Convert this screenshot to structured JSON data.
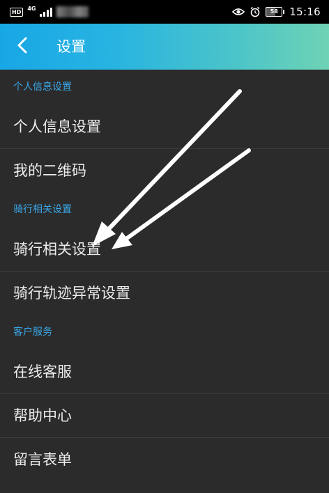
{
  "status_bar": {
    "hd": "HD",
    "network": "4G",
    "battery": "58",
    "time": "15:16"
  },
  "app_bar": {
    "title": "设置"
  },
  "sections": [
    {
      "header": "个人信息设置",
      "items": [
        "个人信息设置",
        "我的二维码"
      ]
    },
    {
      "header": "骑行相关设置",
      "items": [
        "骑行相关设置",
        "骑行轨迹异常设置"
      ]
    },
    {
      "header": "客户服务",
      "items": [
        "在线客服",
        "帮助中心",
        "留言表单"
      ]
    }
  ],
  "colors": {
    "accent": "#3aa7e8",
    "background": "#2b2b2b",
    "app_bar_start": "#18a7e6",
    "app_bar_end": "#6fd3b5"
  }
}
